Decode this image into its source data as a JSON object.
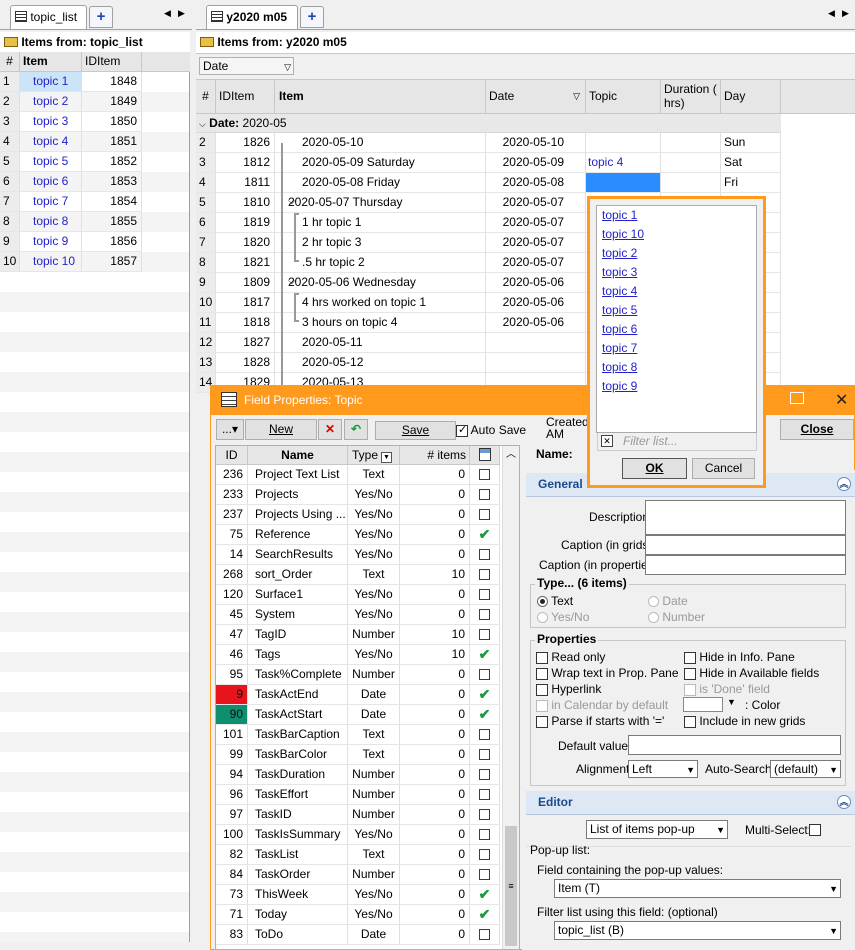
{
  "left_panel": {
    "tab_label": "topic_list",
    "header_prefix": "Items from:",
    "header_source": "topic_list",
    "columns": {
      "rownum": "#",
      "item": "Item",
      "id": "IDItem"
    },
    "rows": [
      {
        "n": "1",
        "item": "topic 1",
        "id": "1848"
      },
      {
        "n": "2",
        "item": "topic 2",
        "id": "1849"
      },
      {
        "n": "3",
        "item": "topic 3",
        "id": "1850"
      },
      {
        "n": "4",
        "item": "topic 4",
        "id": "1851"
      },
      {
        "n": "5",
        "item": "topic 5",
        "id": "1852"
      },
      {
        "n": "6",
        "item": "topic 6",
        "id": "1853"
      },
      {
        "n": "7",
        "item": "topic 7",
        "id": "1854"
      },
      {
        "n": "8",
        "item": "topic 8",
        "id": "1855"
      },
      {
        "n": "9",
        "item": "topic 9",
        "id": "1856"
      },
      {
        "n": "10",
        "item": "topic 10",
        "id": "1857"
      }
    ]
  },
  "right_panel": {
    "tab_label": "y2020 m05",
    "header_prefix": "Items from:",
    "header_source": "y2020 m05",
    "group_select": "Date",
    "columns": {
      "rownum": "#",
      "id": "IDItem",
      "item": "Item",
      "date": "Date",
      "topic": "Topic",
      "duration": "Duration ( hrs)",
      "day": "Day"
    },
    "group_label": "Date:",
    "group_value": "2020-05",
    "rows": [
      {
        "n": "2",
        "id": "1826",
        "item": "2020-05-10",
        "date": "2020-05-10",
        "topic": "",
        "day": "Sun"
      },
      {
        "n": "3",
        "id": "1812",
        "item": "2020-05-09 Saturday",
        "date": "2020-05-09",
        "topic": "topic 4",
        "day": "Sat"
      },
      {
        "n": "4",
        "id": "1811",
        "item": "2020-05-08 Friday",
        "date": "2020-05-08",
        "topic": "",
        "day": "Fri"
      },
      {
        "n": "5",
        "id": "1810",
        "item": "2020-05-07 Thursday",
        "date": "2020-05-07",
        "topic": "",
        "day": ""
      },
      {
        "n": "6",
        "id": "1819",
        "item": "1 hr topic 1",
        "date": "2020-05-07",
        "topic": "",
        "day": ""
      },
      {
        "n": "7",
        "id": "1820",
        "item": "2 hr topic 3",
        "date": "2020-05-07",
        "topic": "",
        "day": ""
      },
      {
        "n": "8",
        "id": "1821",
        "item": ".5 hr topic 2",
        "date": "2020-05-07",
        "topic": "",
        "day": ""
      },
      {
        "n": "9",
        "id": "1809",
        "item": "2020-05-06 Wednesday",
        "date": "2020-05-06",
        "topic": "",
        "day": ""
      },
      {
        "n": "10",
        "id": "1817",
        "item": "4 hrs worked on  topic 1",
        "date": "2020-05-06",
        "topic": "",
        "day": ""
      },
      {
        "n": "11",
        "id": "1818",
        "item": "3 hours on topic 4",
        "date": "2020-05-06",
        "topic": "",
        "day": ""
      },
      {
        "n": "12",
        "id": "1827",
        "item": "2020-05-11",
        "date": "",
        "topic": "",
        "day": ""
      },
      {
        "n": "13",
        "id": "1828",
        "item": "2020-05-12",
        "date": "",
        "topic": "",
        "day": ""
      },
      {
        "n": "14",
        "id": "1829",
        "item": "2020-05-13",
        "date": "",
        "topic": "",
        "day": ""
      }
    ]
  },
  "popup": {
    "items": [
      "topic 1",
      "topic 10",
      "topic 2",
      "topic 3",
      "topic 4",
      "topic 5",
      "topic 6",
      "topic 7",
      "topic 8",
      "topic 9"
    ],
    "filter_placeholder": "Filter list...",
    "ok": "OK",
    "cancel": "Cancel"
  },
  "field_props": {
    "title": "Field Properties: Topic",
    "toolbar": {
      "menu": "...",
      "new": "New",
      "save": "Save",
      "autosave": "Auto Save",
      "close": "Close"
    },
    "created_label": "Created:",
    "created_value": "AM",
    "name_label": "Name:",
    "columns": {
      "id": "ID",
      "name": "Name",
      "type": "Type",
      "items": "# items"
    },
    "rows": [
      {
        "id": "236",
        "name": "Project Text List",
        "type": "Text",
        "count": "0",
        "chk": false
      },
      {
        "id": "233",
        "name": "Projects",
        "type": "Yes/No",
        "count": "0",
        "chk": false
      },
      {
        "id": "237",
        "name": "Projects Using ...",
        "type": "Yes/No",
        "count": "0",
        "chk": false
      },
      {
        "id": "75",
        "name": "Reference",
        "type": "Yes/No",
        "count": "0",
        "chk": true
      },
      {
        "id": "14",
        "name": "SearchResults",
        "type": "Yes/No",
        "count": "0",
        "chk": false
      },
      {
        "id": "268",
        "name": "sort_Order",
        "type": "Text",
        "count": "10",
        "chk": false
      },
      {
        "id": "120",
        "name": "Surface1",
        "type": "Yes/No",
        "count": "0",
        "chk": false
      },
      {
        "id": "45",
        "name": "System",
        "type": "Yes/No",
        "count": "0",
        "chk": false
      },
      {
        "id": "47",
        "name": "TagID",
        "type": "Number",
        "count": "10",
        "chk": false
      },
      {
        "id": "46",
        "name": "Tags",
        "type": "Yes/No",
        "count": "10",
        "chk": true
      },
      {
        "id": "95",
        "name": "Task%Complete",
        "type": "Number",
        "count": "0",
        "chk": false
      },
      {
        "id": "9",
        "name": "TaskActEnd",
        "type": "Date",
        "count": "0",
        "chk": true,
        "color": "#e8141c"
      },
      {
        "id": "90",
        "name": "TaskActStart",
        "type": "Date",
        "count": "0",
        "chk": true,
        "color": "#0e9070"
      },
      {
        "id": "101",
        "name": "TaskBarCaption",
        "type": "Text",
        "count": "0",
        "chk": false
      },
      {
        "id": "99",
        "name": "TaskBarColor",
        "type": "Text",
        "count": "0",
        "chk": false
      },
      {
        "id": "94",
        "name": "TaskDuration",
        "type": "Number",
        "count": "0",
        "chk": false
      },
      {
        "id": "96",
        "name": "TaskEffort",
        "type": "Number",
        "count": "0",
        "chk": false
      },
      {
        "id": "97",
        "name": "TaskID",
        "type": "Number",
        "count": "0",
        "chk": false
      },
      {
        "id": "100",
        "name": "TaskIsSummary",
        "type": "Yes/No",
        "count": "0",
        "chk": false
      },
      {
        "id": "82",
        "name": "TaskList",
        "type": "Text",
        "count": "0",
        "chk": false
      },
      {
        "id": "84",
        "name": "TaskOrder",
        "type": "Number",
        "count": "0",
        "chk": false
      },
      {
        "id": "73",
        "name": "ThisWeek",
        "type": "Yes/No",
        "count": "0",
        "chk": true
      },
      {
        "id": "71",
        "name": "Today",
        "type": "Yes/No",
        "count": "0",
        "chk": true
      },
      {
        "id": "83",
        "name": "ToDo",
        "type": "Date",
        "count": "0",
        "chk": false
      }
    ],
    "general": {
      "title": "General",
      "description": "Description",
      "caption_grids": "Caption (in grids):",
      "caption_props": "Caption (in properties):",
      "type_group": "Type...  (6 items)",
      "types": {
        "text": "Text",
        "date": "Date",
        "yesno": "Yes/No",
        "number": "Number"
      },
      "properties_group": "Properties",
      "read_only": "Read only",
      "hide_info": "Hide in Info. Pane",
      "wrap_text": "Wrap text in Prop. Pane",
      "hide_available": "Hide in Available fields",
      "hyperlink": "Hyperlink",
      "is_done": "is 'Done' field",
      "in_calendar": "in Calendar by default",
      "color": ": Color",
      "parse_if": "Parse if starts with '='",
      "include_new": "Include in new grids",
      "default_value": "Default value:",
      "alignment": "Alignment",
      "alignment_value": "Left",
      "auto_search": "Auto-Search:",
      "auto_search_value": "(default)"
    },
    "editor": {
      "title": "Editor",
      "mode": "List of items pop-up",
      "multi_select": "Multi-Select:",
      "popup_list": "Pop-up list:",
      "field_label": "Field containing the pop-up values:",
      "field_value": "Item (T)",
      "filter_label": "Filter list using this field: (optional)",
      "filter_value": "topic_list (B)"
    }
  },
  "colors": {
    "accent": "#ff9a1c",
    "link": "#2222cc",
    "selection": "#2a8cff"
  }
}
